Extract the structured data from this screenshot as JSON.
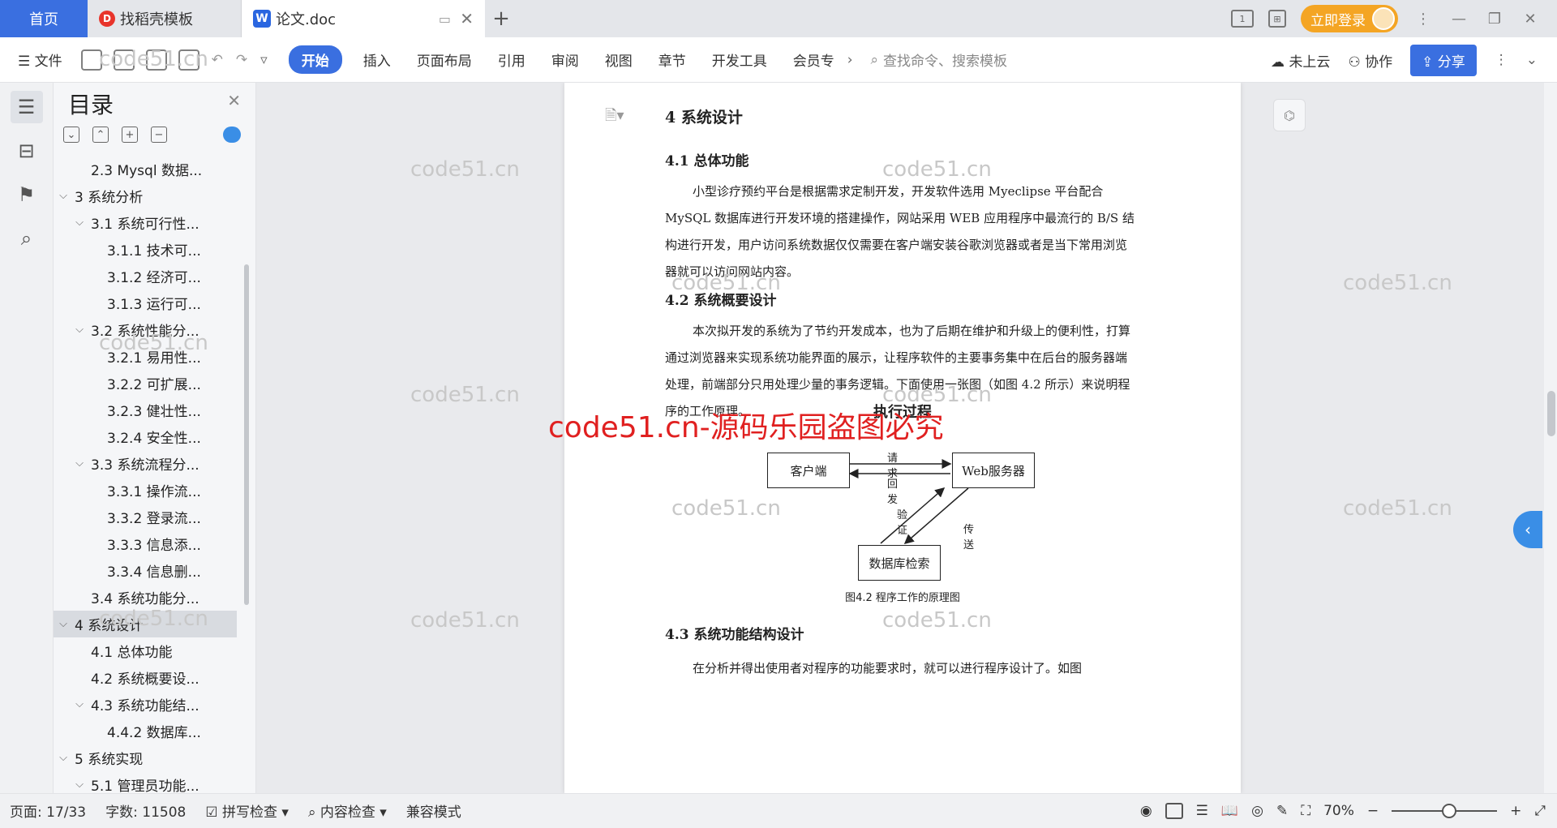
{
  "tabs": {
    "home": "首页",
    "template": "找稻壳模板",
    "doc": "论文.doc"
  },
  "titlebar": {
    "login": "立即登录"
  },
  "ribbon": {
    "file": "文件",
    "start": "开始",
    "menu": [
      "插入",
      "页面布局",
      "引用",
      "审阅",
      "视图",
      "章节",
      "开发工具",
      "会员专"
    ],
    "search_placeholder": "查找命令、搜索模板",
    "cloud": "未上云",
    "collab": "协作",
    "share": "分享"
  },
  "toc": {
    "title": "目录",
    "items": [
      {
        "label": "2.3  Mysql 数据...",
        "level": 2,
        "chevron": ""
      },
      {
        "label": "3  系统分析",
        "level": 1,
        "chevron": "v"
      },
      {
        "label": "3.1  系统可行性...",
        "level": 2,
        "chevron": "v"
      },
      {
        "label": "3.1.1  技术可...",
        "level": 3,
        "chevron": ""
      },
      {
        "label": "3.1.2  经济可...",
        "level": 3,
        "chevron": ""
      },
      {
        "label": "3.1.3  运行可...",
        "level": 3,
        "chevron": ""
      },
      {
        "label": "3.2  系统性能分...",
        "level": 2,
        "chevron": "v"
      },
      {
        "label": "3.2.1  易用性...",
        "level": 3,
        "chevron": ""
      },
      {
        "label": "3.2.2  可扩展...",
        "level": 3,
        "chevron": ""
      },
      {
        "label": "3.2.3  健壮性...",
        "level": 3,
        "chevron": ""
      },
      {
        "label": "3.2.4  安全性...",
        "level": 3,
        "chevron": ""
      },
      {
        "label": "3.3  系统流程分...",
        "level": 2,
        "chevron": "v"
      },
      {
        "label": "3.3.1  操作流...",
        "level": 3,
        "chevron": ""
      },
      {
        "label": "3.3.2  登录流...",
        "level": 3,
        "chevron": ""
      },
      {
        "label": "3.3.3  信息添...",
        "level": 3,
        "chevron": ""
      },
      {
        "label": "3.3.4  信息删...",
        "level": 3,
        "chevron": ""
      },
      {
        "label": "3.4  系统功能分...",
        "level": 2,
        "chevron": ""
      },
      {
        "label": "4  系统设计",
        "level": 1,
        "chevron": "v",
        "selected": true
      },
      {
        "label": "4.1  总体功能",
        "level": 2,
        "chevron": ""
      },
      {
        "label": "4.2  系统概要设...",
        "level": 2,
        "chevron": ""
      },
      {
        "label": "4.3  系统功能结...",
        "level": 2,
        "chevron": "v"
      },
      {
        "label": "4.4.2  数据库...",
        "level": 3,
        "chevron": ""
      },
      {
        "label": "5  系统实现",
        "level": 1,
        "chevron": "v"
      },
      {
        "label": "5.1  管理员功能...",
        "level": 2,
        "chevron": "v"
      }
    ]
  },
  "document": {
    "h1": "4  系统设计",
    "h_41": "4.1  总体功能",
    "p_41": "小型诊疗预约平台是根据需求定制开发，开发软件选用 Myeclipse 平台配合 MySQL 数据库进行开发环境的搭建操作，网站采用 WEB 应用程序中最流行的 B/S 结构进行开发，用户访问系统数据仅仅需要在客户端安装谷歌浏览器或者是当下常用浏览器就可以访问网站内容。",
    "h_42": "4.2  系统概要设计",
    "p_42": "本次拟开发的系统为了节约开发成本，也为了后期在维护和升级上的便利性，打算通过浏览器来实现系统功能界面的展示，让程序软件的主要事务集中在后台的服务器端处理，前端部分只用处理少量的事务逻辑。下面使用一张图（如图 4.2 所示）来说明程序的工作原理。",
    "diagram": {
      "title": "执行过程",
      "client": "客户端",
      "server": "Web服务器",
      "db": "数据库检索",
      "req": "请求",
      "resp": "回发",
      "verify": "验证",
      "transfer": "传送",
      "caption": "图4.2  程序工作的原理图"
    },
    "h_43": "4.3  系统功能结构设计",
    "p_43": "在分析并得出使用者对程序的功能要求时，就可以进行程序设计了。如图"
  },
  "watermarks": {
    "small": "code51.cn",
    "big": "code51.cn-源码乐园盗图必究"
  },
  "status": {
    "page": "页面: 17/33",
    "words": "字数: 11508",
    "spell": "拼写检查",
    "content": "内容检查",
    "compat": "兼容模式",
    "zoom": "70%"
  }
}
